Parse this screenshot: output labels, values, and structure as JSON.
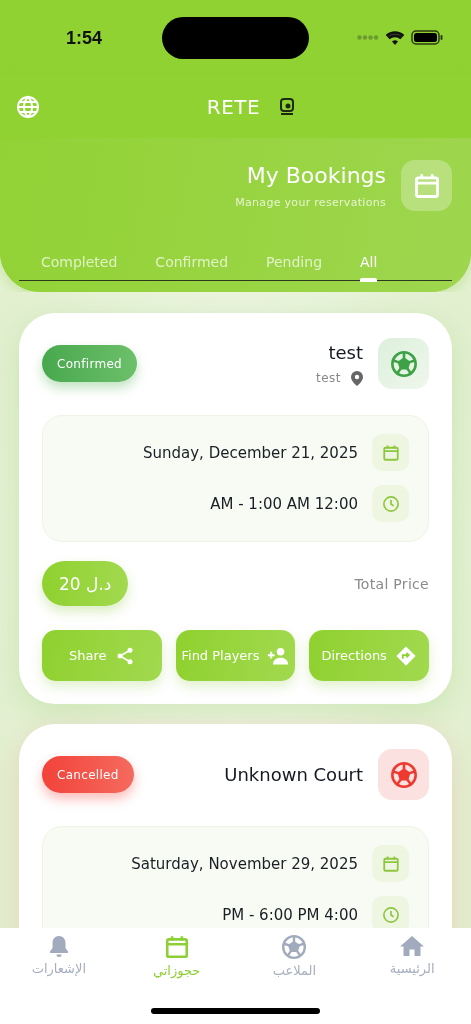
{
  "status_bar": {
    "time": "1:54"
  },
  "header": {
    "app_name": "RETE",
    "title": "My Bookings",
    "subtitle": "Manage your reservations"
  },
  "tabs": [
    {
      "label": "Completed",
      "selected": false
    },
    {
      "label": "Confirmed",
      "selected": false
    },
    {
      "label": "Pending",
      "selected": false
    },
    {
      "label": "All",
      "selected": true
    }
  ],
  "bookings": [
    {
      "status": {
        "label": "Confirmed",
        "kind": "confirmed"
      },
      "court": "test",
      "location": "test",
      "date": "Sunday, December 21, 2025",
      "time": "AM - 1:00 AM 12:00",
      "price": "د.ل 20",
      "price_label": "Total Price",
      "actions": [
        {
          "label": "Share",
          "kind": "share"
        },
        {
          "label": "Find Players",
          "kind": "find_players"
        },
        {
          "label": "Directions",
          "kind": "directions"
        }
      ]
    },
    {
      "status": {
        "label": "Cancelled",
        "kind": "cancelled"
      },
      "court": "Unknown Court",
      "date": "Saturday, November 29, 2025",
      "time": "PM - 6:00 PM 4:00"
    }
  ],
  "bottom_nav": [
    {
      "label": "الرئيسية",
      "kind": "home",
      "selected": false
    },
    {
      "label": "الملاعب",
      "kind": "courts",
      "selected": false
    },
    {
      "label": "حجوزاتي",
      "kind": "bookings",
      "selected": true
    },
    {
      "label": "الإشعارات",
      "kind": "notifications",
      "selected": false
    }
  ]
}
